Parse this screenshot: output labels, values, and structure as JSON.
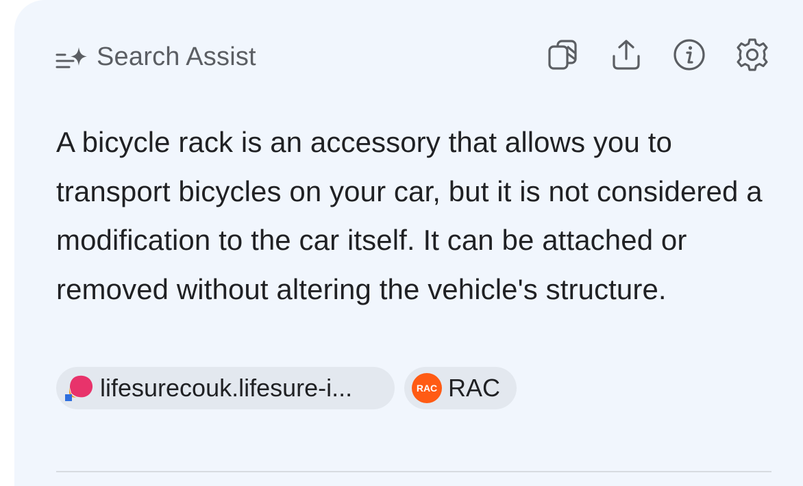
{
  "header": {
    "title": "Search Assist",
    "title_icon": "sparkle-list-icon",
    "actions": [
      {
        "name": "copy-button",
        "icon": "copy-icon"
      },
      {
        "name": "share-button",
        "icon": "share-icon"
      },
      {
        "name": "info-button",
        "icon": "info-icon"
      },
      {
        "name": "settings-button",
        "icon": "gear-icon"
      }
    ]
  },
  "answer": {
    "text": "A bicycle rack is an accessory that allows you to transport bicycles on your car, but it is not considered a modification to the car itself. It can be attached or removed without altering the vehicle's structure."
  },
  "sources": [
    {
      "label": "lifesurecouk.lifesure-i...",
      "icon": "lifesure-logo-icon"
    },
    {
      "label": "RAC",
      "icon": "rac-logo-icon",
      "logo_text": "RAC"
    }
  ],
  "colors": {
    "card_background": "#f1f6fd",
    "chip_background": "#e3e8ef",
    "text": "#202124",
    "header_text": "#5b5e63",
    "rac_orange": "#ff5b14",
    "lifesure_pink": "#e8336b"
  }
}
